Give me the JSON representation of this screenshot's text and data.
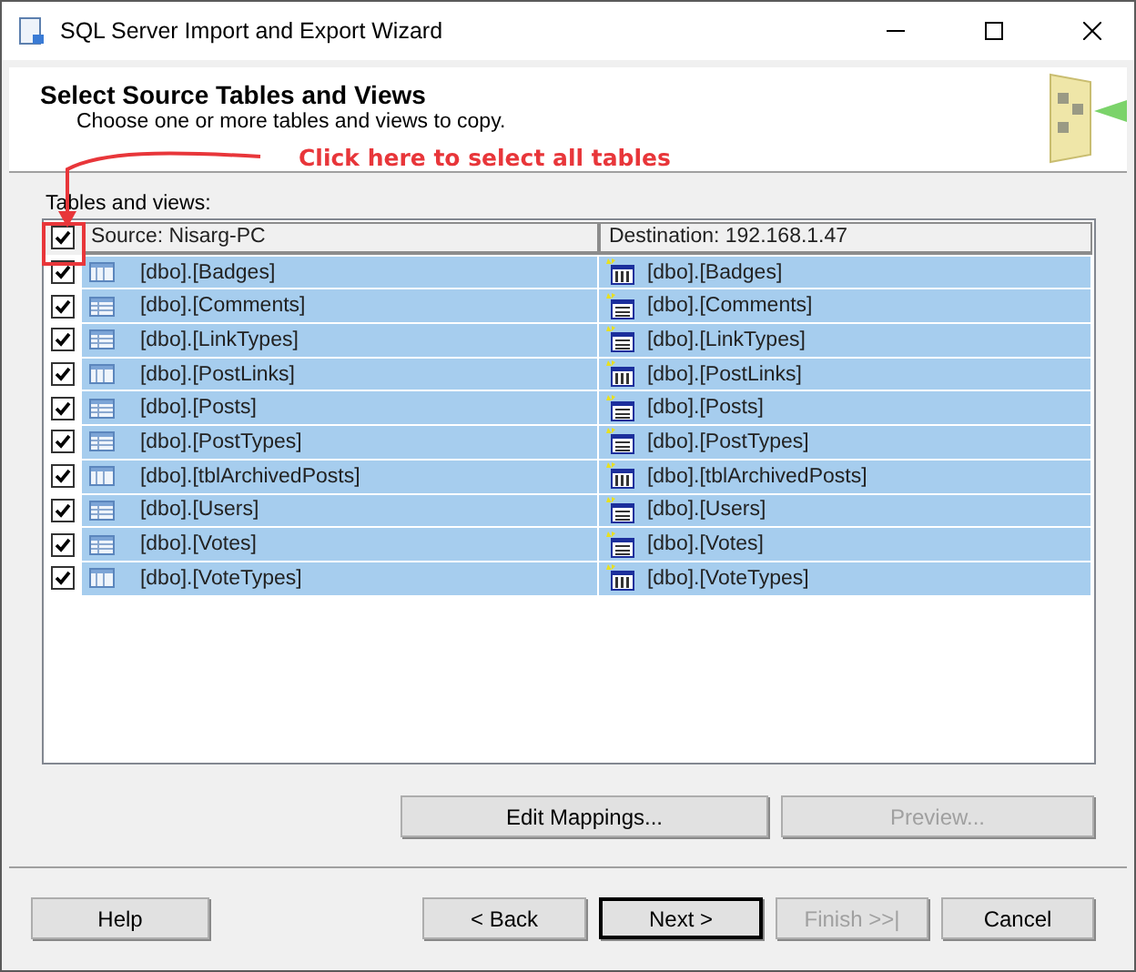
{
  "window": {
    "title": "SQL Server Import and Export Wizard"
  },
  "header": {
    "title": "Select Source Tables and Views",
    "subtitle": "Choose one or more tables and views to copy."
  },
  "annotation": {
    "text": "Click here to select all tables"
  },
  "list_label": "Tables and views:",
  "grid": {
    "select_all_checked": true,
    "columns": [
      "Source: Nisarg-PC",
      "Destination: 192.168.1.47"
    ],
    "rows": [
      {
        "source": "[dbo].[Badges]",
        "destination": "[dbo].[Badges]",
        "checked": true,
        "selected": true,
        "kind": "columns"
      },
      {
        "source": "[dbo].[Comments]",
        "destination": "[dbo].[Comments]",
        "checked": true,
        "selected": true,
        "kind": "grid"
      },
      {
        "source": "[dbo].[LinkTypes]",
        "destination": "[dbo].[LinkTypes]",
        "checked": true,
        "selected": true,
        "kind": "grid"
      },
      {
        "source": "[dbo].[PostLinks]",
        "destination": "[dbo].[PostLinks]",
        "checked": true,
        "selected": true,
        "kind": "columns"
      },
      {
        "source": "[dbo].[Posts]",
        "destination": "[dbo].[Posts]",
        "checked": true,
        "selected": true,
        "kind": "grid"
      },
      {
        "source": "[dbo].[PostTypes]",
        "destination": "[dbo].[PostTypes]",
        "checked": true,
        "selected": true,
        "kind": "grid"
      },
      {
        "source": "[dbo].[tblArchivedPosts]",
        "destination": "[dbo].[tblArchivedPosts]",
        "checked": true,
        "selected": true,
        "kind": "columns"
      },
      {
        "source": "[dbo].[Users]",
        "destination": "[dbo].[Users]",
        "checked": true,
        "selected": true,
        "kind": "grid"
      },
      {
        "source": "[dbo].[Votes]",
        "destination": "[dbo].[Votes]",
        "checked": true,
        "selected": true,
        "kind": "grid"
      },
      {
        "source": "[dbo].[VoteTypes]",
        "destination": "[dbo].[VoteTypes]",
        "checked": true,
        "selected": true,
        "kind": "columns"
      }
    ]
  },
  "grid_buttons": [
    {
      "label": "Edit Mappings...",
      "disabled": false
    },
    {
      "label": "Preview...",
      "disabled": true
    }
  ],
  "footer_buttons": [
    {
      "label": "Help",
      "disabled": false,
      "default": false
    },
    {
      "label": "< Back",
      "disabled": false,
      "default": false
    },
    {
      "label": "Next >",
      "disabled": false,
      "default": true
    },
    {
      "label": "Finish >>|",
      "disabled": true,
      "default": false
    },
    {
      "label": "Cancel",
      "disabled": false,
      "default": false
    }
  ]
}
